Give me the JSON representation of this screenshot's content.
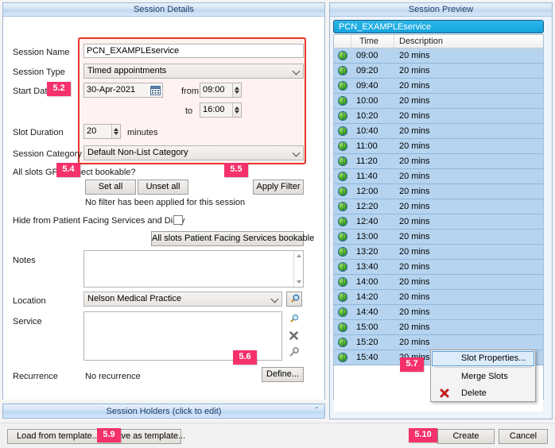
{
  "details": {
    "title": "Session Details",
    "labels": {
      "session_name": "Session Name",
      "session_type": "Session Type",
      "start_date": "Start Date",
      "from": "from",
      "to": "to",
      "slot_duration": "Slot Duration",
      "minutes": "minutes",
      "session_category": "Session Category",
      "gp_connect_question": "All slots GP Connect bookable?",
      "no_filter": "No filter has been applied for this session",
      "hide_from_pfs": "Hide from Patient Facing Services and Diary",
      "notes": "Notes",
      "location": "Location",
      "service": "Service",
      "recurrence": "Recurrence",
      "no_recurrence": "No recurrence"
    },
    "values": {
      "session_name": "PCN_EXAMPLEservice",
      "session_type": "Timed appointments",
      "start_date": "30-Apr-2021",
      "time_from": "09:00",
      "time_to": "16:00",
      "slot_duration": "20",
      "session_category": "Default Non-List Category",
      "notes": "",
      "location": "Nelson Medical Practice",
      "service": ""
    },
    "buttons": {
      "set_all": "Set all",
      "unset_all": "Unset all",
      "apply_filter": "Apply Filter",
      "all_slots_pfs_bookable": "All slots Patient Facing Services bookable",
      "define": "Define..."
    },
    "hide_from_pfs_checked": false
  },
  "holders_bar": {
    "label": "Session Holders (click to edit)",
    "chevron": "ˇ"
  },
  "bottom": {
    "load_from_template": "Load from template...",
    "save_as_template": "Save as template...",
    "create": "Create",
    "cancel": "Cancel"
  },
  "preview": {
    "title": "Session Preview",
    "list_header": "PCN_EXAMPLEservice",
    "columns": [
      "",
      "Time",
      "Description"
    ],
    "rows": [
      {
        "icon": "globe-icon",
        "time": "09:00",
        "description": "20 mins"
      },
      {
        "icon": "globe-icon",
        "time": "09:20",
        "description": "20 mins"
      },
      {
        "icon": "globe-icon",
        "time": "09:40",
        "description": "20 mins"
      },
      {
        "icon": "globe-icon",
        "time": "10:00",
        "description": "20 mins"
      },
      {
        "icon": "globe-icon",
        "time": "10:20",
        "description": "20 mins"
      },
      {
        "icon": "globe-icon",
        "time": "10:40",
        "description": "20 mins"
      },
      {
        "icon": "globe-icon",
        "time": "11:00",
        "description": "20 mins"
      },
      {
        "icon": "globe-icon",
        "time": "11:20",
        "description": "20 mins"
      },
      {
        "icon": "globe-icon",
        "time": "11:40",
        "description": "20 mins"
      },
      {
        "icon": "globe-icon",
        "time": "12:00",
        "description": "20 mins"
      },
      {
        "icon": "globe-icon",
        "time": "12:20",
        "description": "20 mins"
      },
      {
        "icon": "globe-icon",
        "time": "12:40",
        "description": "20 mins"
      },
      {
        "icon": "globe-icon",
        "time": "13:00",
        "description": "20 mins"
      },
      {
        "icon": "globe-icon",
        "time": "13:20",
        "description": "20 mins"
      },
      {
        "icon": "globe-icon",
        "time": "13:40",
        "description": "20 mins"
      },
      {
        "icon": "globe-icon",
        "time": "14:00",
        "description": "20 mins"
      },
      {
        "icon": "globe-icon",
        "time": "14:20",
        "description": "20 mins"
      },
      {
        "icon": "globe-icon",
        "time": "14:40",
        "description": "20 mins"
      },
      {
        "icon": "globe-icon",
        "time": "15:00",
        "description": "20 mins"
      },
      {
        "icon": "globe-icon",
        "time": "15:20",
        "description": "20 mins"
      },
      {
        "icon": "globe-icon",
        "time": "15:40",
        "description": "20 mins"
      }
    ]
  },
  "context_menu": {
    "items": [
      {
        "label": "Slot Properties...",
        "selected": true,
        "icon": ""
      },
      {
        "label": "Merge Slots",
        "selected": false,
        "icon": ""
      },
      {
        "label": "Delete",
        "selected": false,
        "icon": "delete-x-icon"
      }
    ]
  },
  "badges": [
    {
      "id": "5.2",
      "label": "5.2"
    },
    {
      "id": "5.4",
      "label": "5.4"
    },
    {
      "id": "5.5",
      "label": "5.5"
    },
    {
      "id": "5.6",
      "label": "5.6"
    },
    {
      "id": "5.7",
      "label": "5.7"
    },
    {
      "id": "5.9",
      "label": "5.9"
    },
    {
      "id": "5.10",
      "label": "5.10"
    }
  ],
  "colors": {
    "badge_pink": "#f5316b",
    "highlight_red": "#e8342a",
    "panel_title_blue": "#1f3c66",
    "list_header_cyan": "#14a4dd",
    "row_selected_blue": "#b6d4ef"
  }
}
